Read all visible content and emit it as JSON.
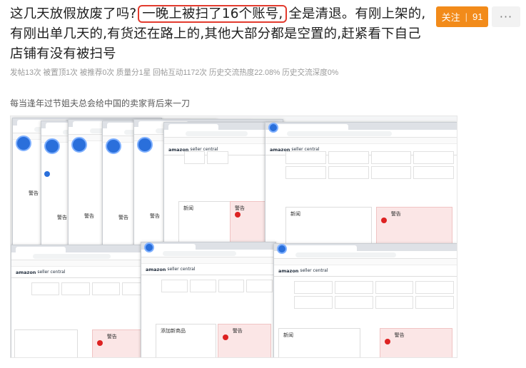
{
  "post": {
    "title_before": "这几天放假放废了吗?",
    "title_highlight": "一晚上被扫了16个账号,",
    "title_after": "全是清退。有刚上架的,有刚出单几天的,有货还在路上的,其他大部分都是空置的,赶紧看下自己店铺有没有被扫号",
    "follow_label": "关注",
    "follow_count": "91",
    "more_label": "···",
    "stats": "发帖13次 被置顶1次 被推荐0次 质量分1星 回帖互动1172次 历史交流热度22.08% 历史交流深度0%",
    "caption": "每当逢年过节姐夫总会给中国的卖家背后来一刀"
  },
  "screenshot": {
    "header_brand": "amazon",
    "header_product": "seller central",
    "panel_news": "新闻",
    "panel_warning": "警告",
    "panel_add_product": "添加新商品",
    "url": "sellercentral.amazon.com/home"
  },
  "colors": {
    "highlight_border": "#e23b2e",
    "follow_button": "#f28b1a",
    "warning_panel": "#fbe6e6"
  }
}
